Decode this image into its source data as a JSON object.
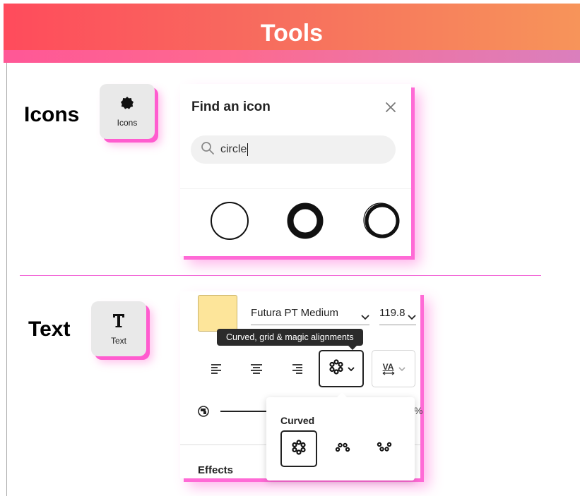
{
  "header": {
    "title": "Tools"
  },
  "icons_section": {
    "title": "Icons",
    "tile": {
      "icon": "badge-icon",
      "label": "Icons"
    }
  },
  "icon_finder": {
    "title": "Find an icon",
    "close_icon": "close-icon",
    "search": {
      "icon": "search-icon",
      "value": "circle"
    },
    "results": [
      "circle-outline-thin",
      "circle-outline-thick",
      "circle-outline-brush"
    ]
  },
  "text_section": {
    "title": "Text",
    "tile": {
      "icon": "text-t-icon",
      "label": "Text"
    }
  },
  "text_panel": {
    "swatch_color": "#fde59a",
    "font_family": "Futura PT Medium",
    "font_size": "119.8",
    "tooltip": "Curved, grid & magic alignments",
    "align_buttons": [
      "align-left-icon",
      "align-center-icon",
      "align-right-icon"
    ],
    "alignment_mode_icon": "circle-text-icon",
    "spacing_label": "VA",
    "percent_symbol": "%",
    "effects_label": "Effects",
    "popover": {
      "title": "Curved",
      "options": [
        "full-circle-icon",
        "arc-up-icon",
        "arc-down-icon"
      ],
      "selected_index": 0
    }
  },
  "colors": {
    "header_gradient_start": "#ff4b5c",
    "header_gradient_end": "#f7945a",
    "accent_pink": "#ff5ccf",
    "divider_pink": "#f36ad8"
  }
}
